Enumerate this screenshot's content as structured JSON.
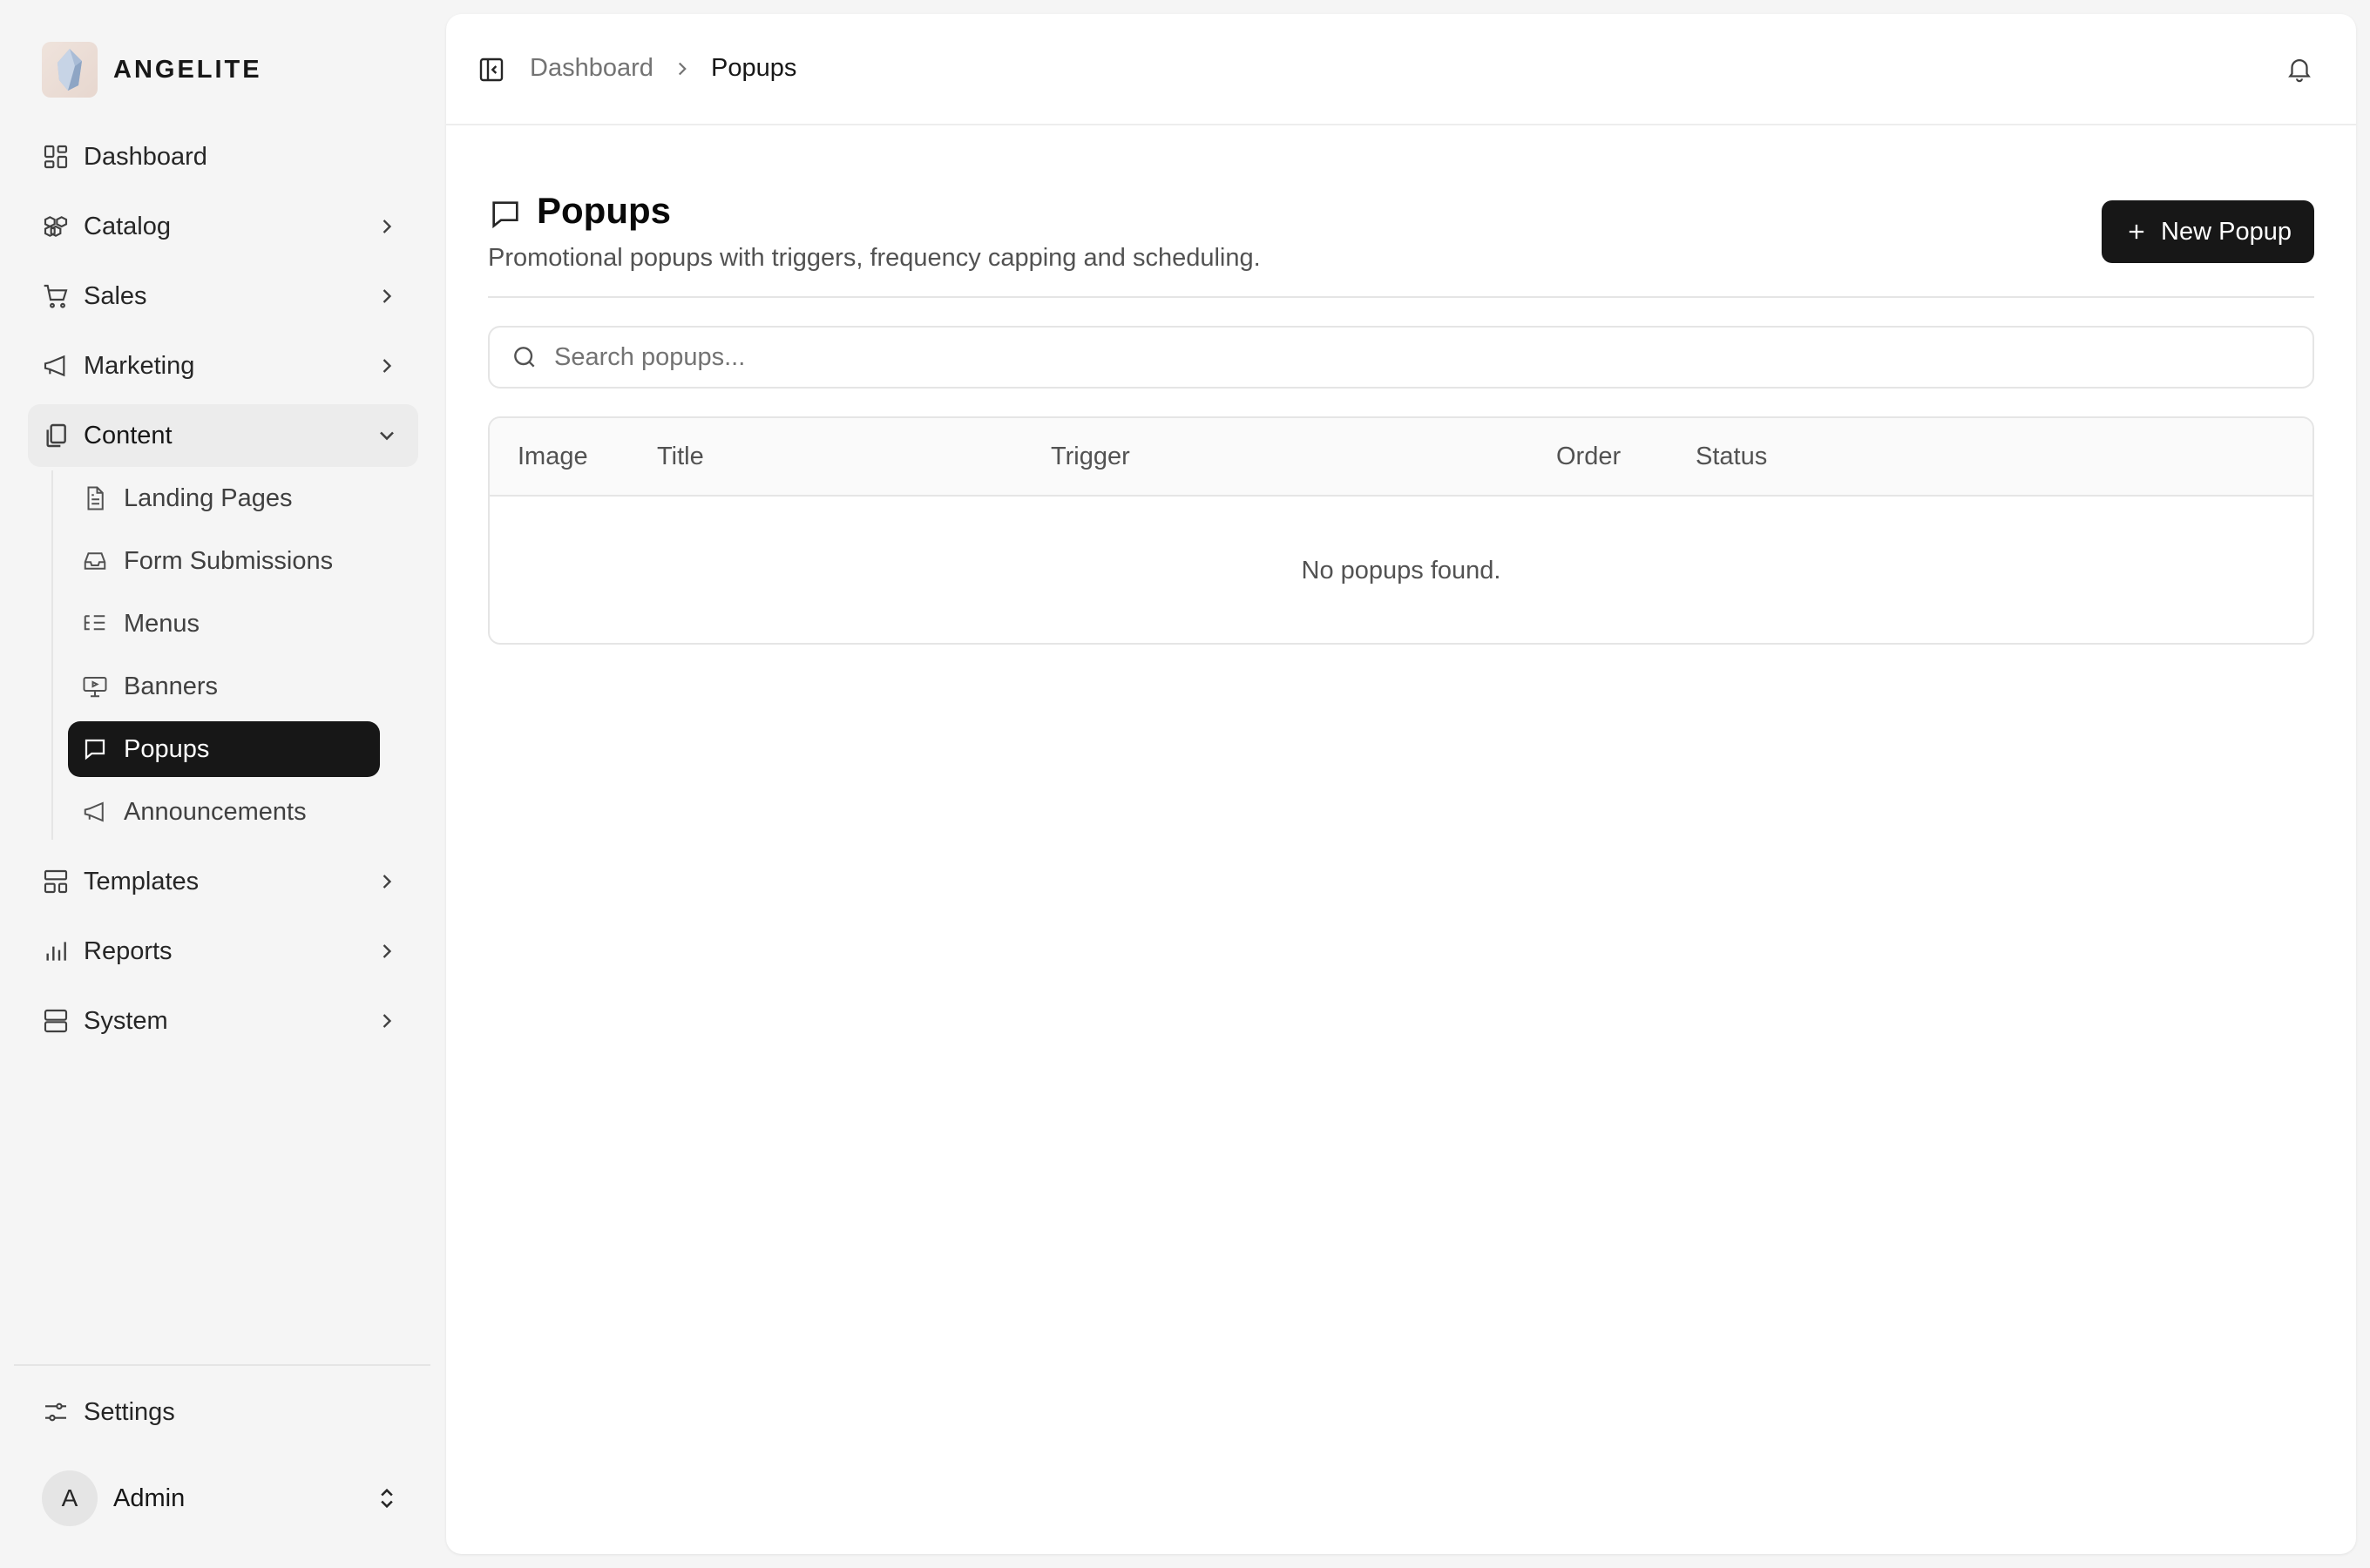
{
  "brand": {
    "name": "ANGELITE"
  },
  "sidebar": {
    "items": [
      {
        "label": "Dashboard",
        "icon": "dashboard-icon"
      },
      {
        "label": "Catalog",
        "icon": "catalog-icon"
      },
      {
        "label": "Sales",
        "icon": "cart-icon"
      },
      {
        "label": "Marketing",
        "icon": "megaphone-icon"
      },
      {
        "label": "Content",
        "icon": "content-icon",
        "expanded": true
      },
      {
        "label": "Templates",
        "icon": "templates-icon"
      },
      {
        "label": "Reports",
        "icon": "bar-chart-icon"
      },
      {
        "label": "System",
        "icon": "server-icon"
      }
    ],
    "content_sub": [
      {
        "label": "Landing Pages",
        "icon": "file-text-icon"
      },
      {
        "label": "Form Submissions",
        "icon": "inbox-icon"
      },
      {
        "label": "Menus",
        "icon": "list-tree-icon"
      },
      {
        "label": "Banners",
        "icon": "presentation-icon"
      },
      {
        "label": "Popups",
        "icon": "message-square-icon",
        "active": true
      },
      {
        "label": "Announcements",
        "icon": "megaphone-icon"
      }
    ],
    "settings": {
      "label": "Settings",
      "icon": "sliders-icon"
    },
    "user": {
      "initial": "A",
      "name": "Admin"
    }
  },
  "breadcrumb": {
    "root": "Dashboard",
    "current": "Popups"
  },
  "page": {
    "title": "Popups",
    "subtitle": "Promotional popups with triggers, frequency capping and scheduling.",
    "new_button": "New Popup"
  },
  "search": {
    "placeholder": "Search popups..."
  },
  "table": {
    "columns": [
      "Image",
      "Title",
      "Trigger",
      "Order",
      "Status"
    ],
    "empty_text": "No popups found."
  },
  "colors": {
    "accent": "#171717",
    "background": "#f5f5f5",
    "surface": "#ffffff",
    "border": "#e5e5e5"
  }
}
